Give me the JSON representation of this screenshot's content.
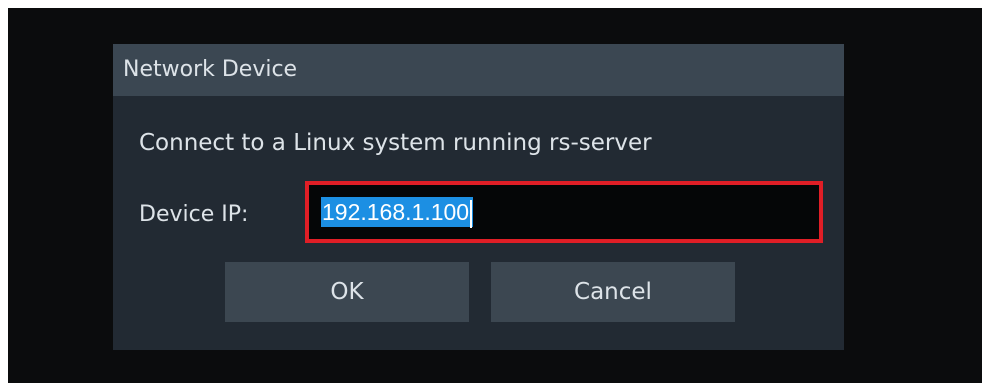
{
  "dialog": {
    "title": "Network Device",
    "description": "Connect to a Linux system running rs-server",
    "ip_label": "Device IP:",
    "ip_value": "192.168.1.100",
    "ok_label": "OK",
    "cancel_label": "Cancel"
  },
  "colors": {
    "backdrop": "#0b0c0d",
    "dialog_bg": "#222a33",
    "titlebar_bg": "#3b4752",
    "button_bg": "#3c4751",
    "text": "#dde3e8",
    "selection": "#1c8fe3",
    "highlight_border": "#e01e26"
  }
}
